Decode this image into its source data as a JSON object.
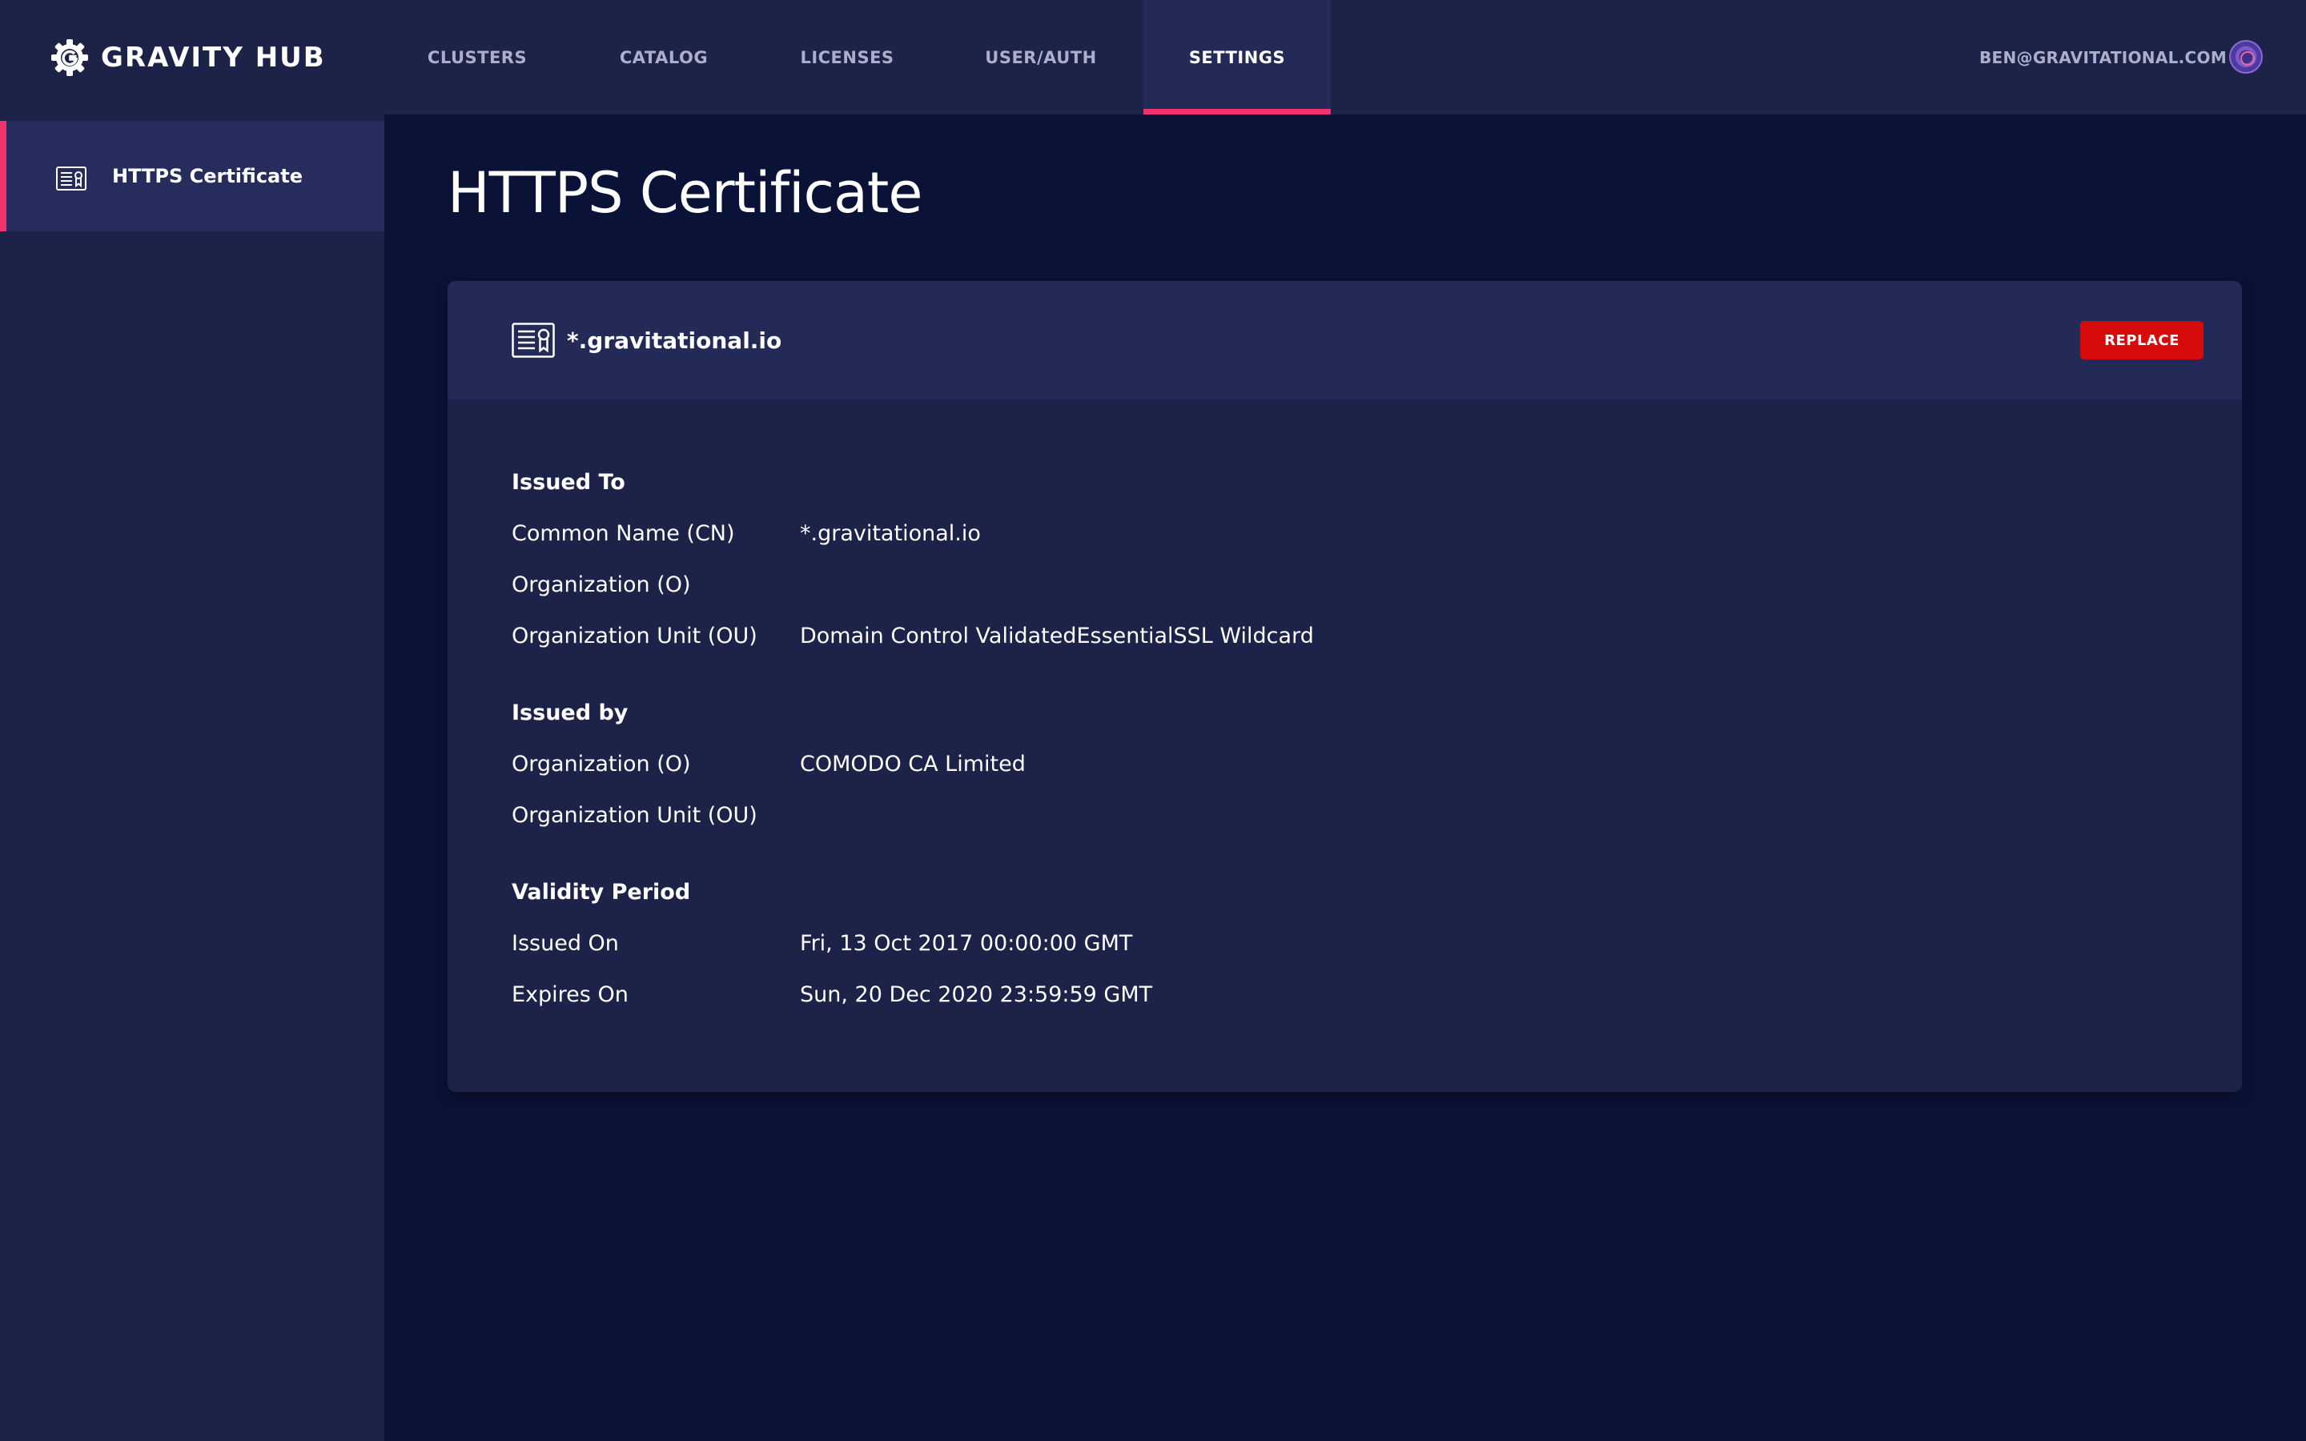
{
  "brand": {
    "name": "GRAVITY HUB",
    "icon": "gear-logo-icon"
  },
  "nav": {
    "tabs": [
      {
        "label": "CLUSTERS",
        "active": false
      },
      {
        "label": "CATALOG",
        "active": false
      },
      {
        "label": "LICENSES",
        "active": false
      },
      {
        "label": "USER/AUTH",
        "active": false
      },
      {
        "label": "SETTINGS",
        "active": true
      }
    ],
    "accent_color": "#f0336c"
  },
  "user": {
    "email": "BEN@GRAVITATIONAL.COM",
    "avatar_icon": "avatar-icon"
  },
  "sidebar": {
    "items": [
      {
        "label": "HTTPS Certificate",
        "icon": "certificate-icon",
        "active": true
      }
    ]
  },
  "page": {
    "title": "HTTPS Certificate"
  },
  "certificate": {
    "name": "*.gravitational.io",
    "icon": "certificate-icon",
    "replace_label": "REPLACE",
    "replace_color": "#d70b0b",
    "sections": {
      "issued_to": {
        "title": "Issued To",
        "rows": [
          {
            "label": "Common Name (CN)",
            "value": "*.gravitational.io"
          },
          {
            "label": "Organization (O)",
            "value": ""
          },
          {
            "label": "Organization Unit (OU)",
            "value": "Domain Control ValidatedEssentialSSL Wildcard"
          }
        ]
      },
      "issued_by": {
        "title": "Issued by",
        "rows": [
          {
            "label": "Organization (O)",
            "value": "COMODO CA Limited"
          },
          {
            "label": "Organization Unit (OU)",
            "value": ""
          }
        ]
      },
      "validity": {
        "title": "Validity Period",
        "rows": [
          {
            "label": "Issued On",
            "value": "Fri, 13 Oct 2017 00:00:00 GMT"
          },
          {
            "label": "Expires On",
            "value": "Sun, 20 Dec 2020 23:59:59 GMT"
          }
        ]
      }
    }
  }
}
